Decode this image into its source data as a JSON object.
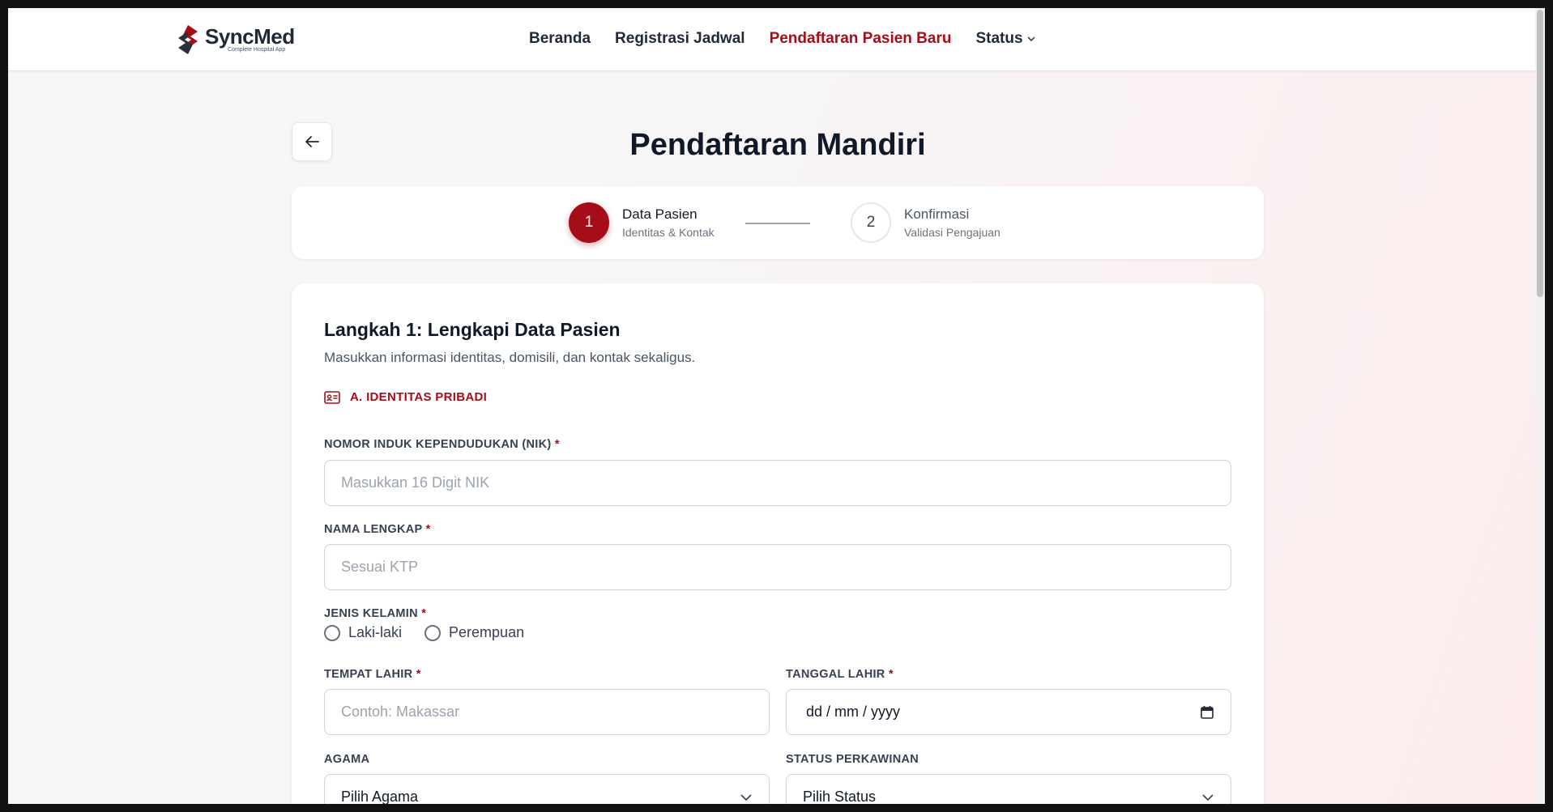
{
  "brand": {
    "name": "SyncMed",
    "tagline": "Complete Hospital App",
    "accent": "#a50e19"
  },
  "nav": {
    "items": [
      {
        "label": "Beranda",
        "active": false
      },
      {
        "label": "Registrasi Jadwal",
        "active": false
      },
      {
        "label": "Pendaftaran Pasien Baru",
        "active": true
      },
      {
        "label": "Status",
        "active": false,
        "dropdown": true
      }
    ]
  },
  "page": {
    "title": "Pendaftaran Mandiri"
  },
  "stepper": {
    "steps": [
      {
        "number": "1",
        "title": "Data Pasien",
        "subtitle": "Identitas & Kontak",
        "active": true
      },
      {
        "number": "2",
        "title": "Konfirmasi",
        "subtitle": "Validasi Pengajuan",
        "active": false
      }
    ]
  },
  "form": {
    "title": "Langkah 1: Lengkapi Data Pasien",
    "subtitle": "Masukkan informasi identitas, domisili, dan kontak sekaligus.",
    "section_a": "A. IDENTITAS PRIBADI",
    "required_mark": "*",
    "nik": {
      "label": "NOMOR INDUK KEPENDUDUKAN (NIK)",
      "placeholder": "Masukkan 16 Digit NIK"
    },
    "nama": {
      "label": "NAMA LENGKAP",
      "placeholder": "Sesuai KTP"
    },
    "gender": {
      "label": "JENIS KELAMIN",
      "options": [
        "Laki-laki",
        "Perempuan"
      ]
    },
    "tempat_lahir": {
      "label": "TEMPAT LAHIR",
      "placeholder": "Contoh: Makassar"
    },
    "tanggal_lahir": {
      "label": "TANGGAL LAHIR",
      "value": "dd / mm / yyyy"
    },
    "agama": {
      "label": "AGAMA",
      "value": "Pilih Agama"
    },
    "status_perkawinan": {
      "label": "STATUS PERKAWINAN",
      "value": "Pilih Status"
    }
  },
  "icons": {
    "back": "arrow-left-icon",
    "section_a": "id-card-icon",
    "calendar": "calendar-icon",
    "dropdown": "chevron-down-icon"
  }
}
